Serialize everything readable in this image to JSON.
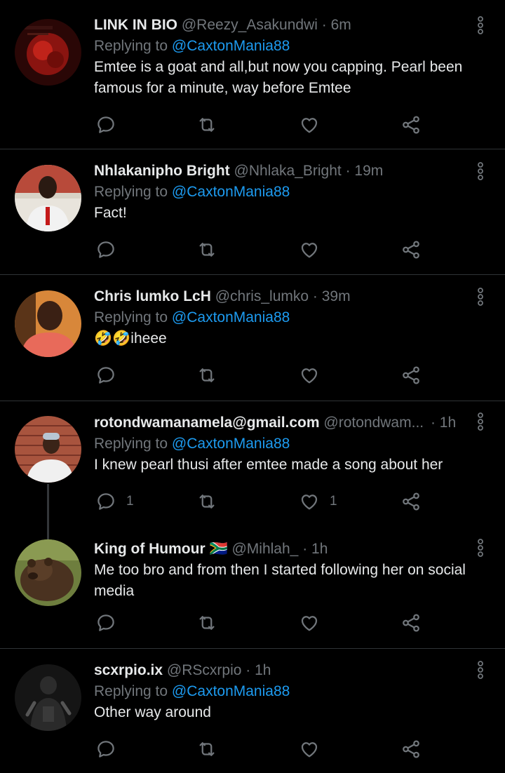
{
  "tweets": [
    {
      "name": "LINK IN BIO",
      "handle": "@Reezy_Asakundwi",
      "time": "· 6m",
      "replying_prefix": "Replying to ",
      "replying_to": "@CaxtonMania88",
      "text": "Emtee is a goat and all,but now you capping. Pearl been famous for a minute, way before Emtee",
      "reply_count": "",
      "like_count": ""
    },
    {
      "name": "Nhlakanipho Bright",
      "handle": "@Nhlaka_Bright",
      "time": "· 19m",
      "replying_prefix": "Replying to ",
      "replying_to": "@CaxtonMania88",
      "text": "Fact!",
      "reply_count": "",
      "like_count": ""
    },
    {
      "name": "Chris lumko LcH",
      "handle": "@chris_lumko",
      "time": "· 39m",
      "replying_prefix": "Replying to ",
      "replying_to": "@CaxtonMania88",
      "text": "🤣🤣iheee",
      "reply_count": "",
      "like_count": ""
    },
    {
      "name": "rotondwamanamela@gmail.com",
      "handle": "@rotondwam...",
      "time": "· 1h",
      "replying_prefix": "Replying to ",
      "replying_to": "@CaxtonMania88",
      "text": "I knew pearl thusi after emtee made a song about her",
      "reply_count": "1",
      "like_count": "1"
    },
    {
      "name": "King of Humour",
      "flag": "🇿🇦",
      "handle": "@Mihlah_",
      "time": "· 1h",
      "text": "Me too bro and from then I started following her on social media",
      "reply_count": "",
      "like_count": ""
    },
    {
      "name": "scxrpio.ix",
      "handle": "@RScxrpio",
      "time": "· 1h",
      "replying_prefix": "Replying to ",
      "replying_to": "@CaxtonMania88",
      "text": "Other way around",
      "reply_count": "",
      "like_count": ""
    }
  ],
  "icons": {
    "reply": "reply-icon",
    "retweet": "retweet-icon",
    "like": "like-icon",
    "share": "share-icon",
    "more": "more-icon"
  },
  "colors": {
    "background": "#000000",
    "text": "#e7e9ea",
    "secondary": "#71767b",
    "mention": "#1d9bf0",
    "divider": "#2f3336"
  }
}
